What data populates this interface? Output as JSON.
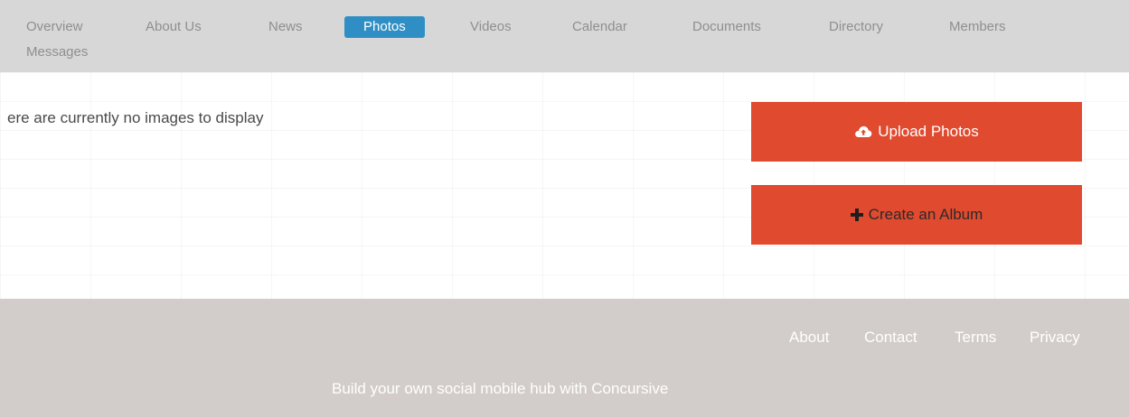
{
  "nav": {
    "items": [
      {
        "label": "Overview"
      },
      {
        "label": "About Us"
      },
      {
        "label": "News"
      },
      {
        "label": "Photos"
      },
      {
        "label": "Videos"
      },
      {
        "label": "Calendar"
      },
      {
        "label": "Documents"
      },
      {
        "label": "Directory"
      },
      {
        "label": "Members"
      },
      {
        "label": "Messages"
      }
    ],
    "active_label": "Photos",
    "active_color": "#2f8fc4"
  },
  "main": {
    "empty_message": "ere are currently no images to display",
    "upload_button": {
      "label": "Upload Photos",
      "icon": "cloud-upload-icon"
    },
    "album_button": {
      "label": "Create an Album",
      "icon": "plus-icon"
    },
    "button_color": "#e04a2f"
  },
  "footer": {
    "links": [
      {
        "label": "About"
      },
      {
        "label": "Contact"
      },
      {
        "label": "Terms"
      },
      {
        "label": "Privacy"
      }
    ],
    "tagline": "Build your own social mobile hub with Concursive",
    "background_color": "#d2cdca"
  }
}
